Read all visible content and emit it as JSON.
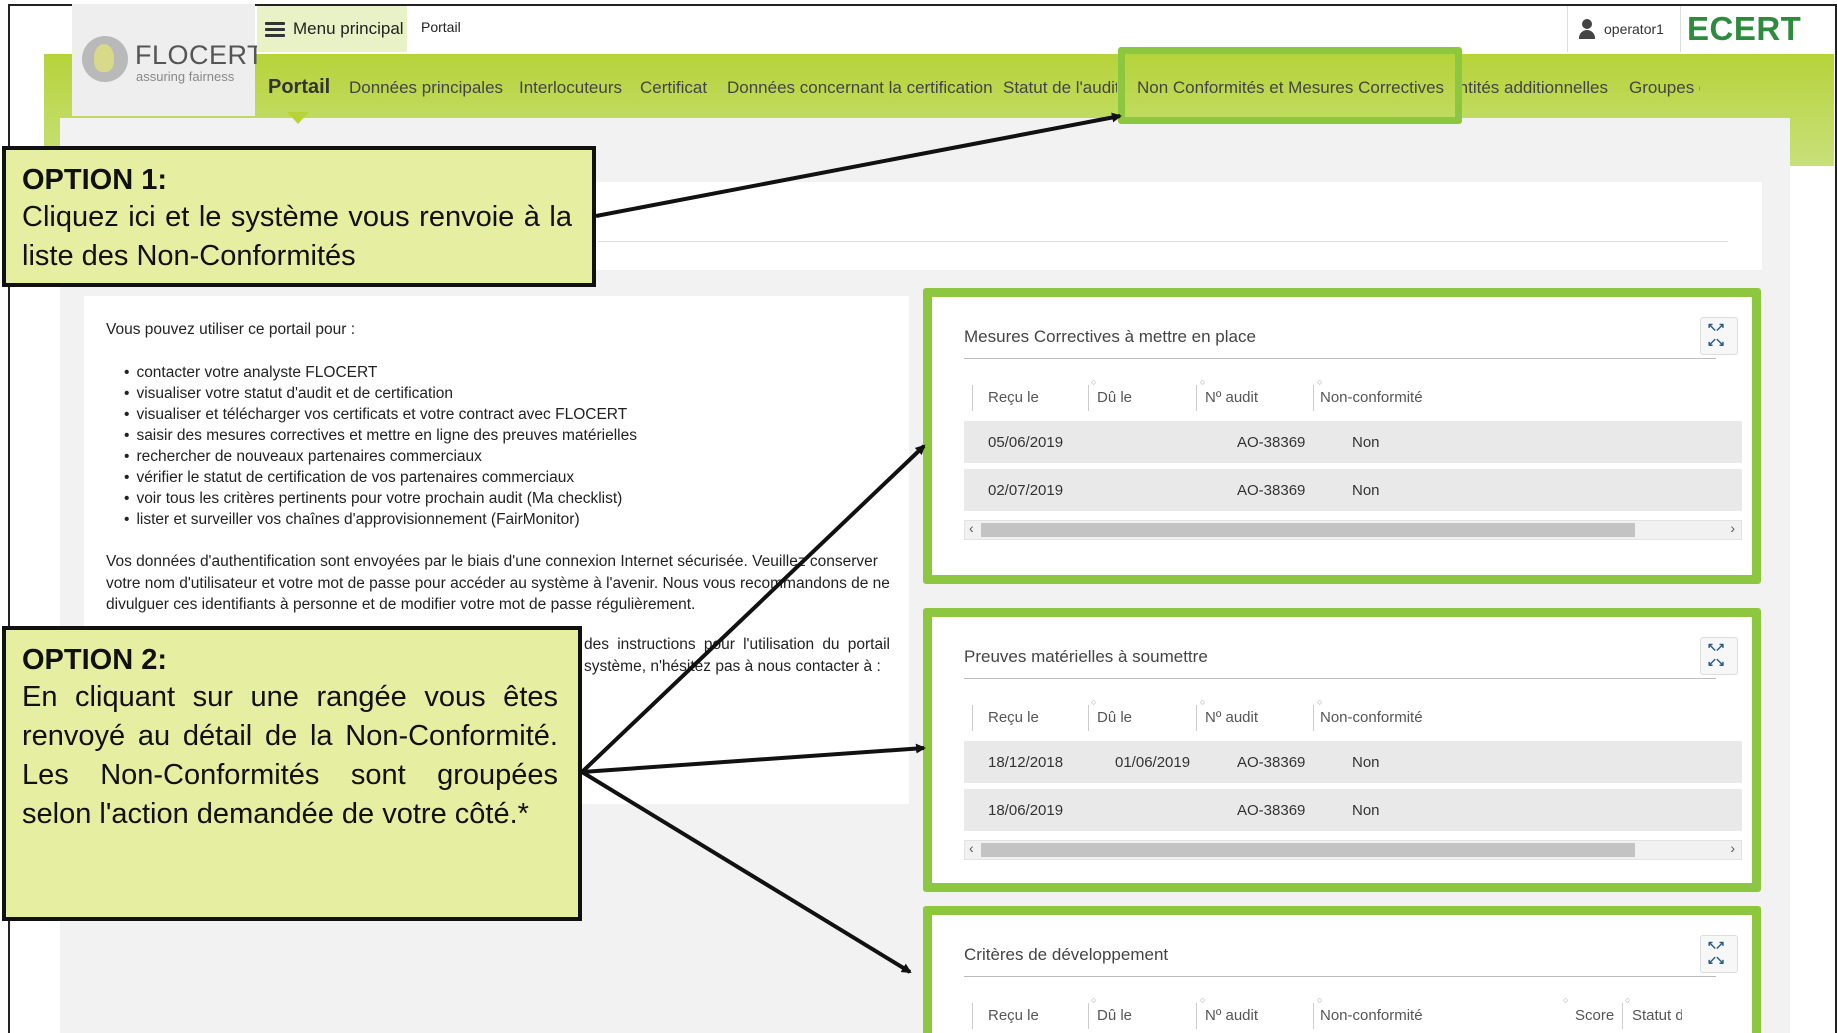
{
  "header": {
    "logo_name": "FLOCERT",
    "logo_tagline": "assuring fairness",
    "menu_label": "Menu principal",
    "breadcrumb": "Portail",
    "user": "operator1",
    "brand": "ECERT"
  },
  "nav": {
    "items": [
      "Portail",
      "Données principales",
      "Interlocuteurs",
      "Certificat",
      "Données concernant la certification",
      "Statut de l'audit",
      "Non Conformités et Mesures Correctives",
      "Entités additionnelles",
      "Groupes d"
    ],
    "active": "Portail"
  },
  "info": {
    "intro": "Vous pouvez utiliser ce portail pour :",
    "bullets": [
      "contacter votre analyste FLOCERT",
      "visualiser votre statut d'audit et de certification",
      "visualiser et télécharger vos certificats et votre contract avec FLOCERT",
      "saisir des mesures correctives et mettre en ligne des preuves matérielles",
      "rechercher de nouveaux partenaires commerciaux",
      "vérifier le statut de certification de vos partenaires commerciaux",
      "voir tous les critères pertinents pour votre prochain audit (Ma checklist)",
      "lister et surveiller vos chaînes d'approvisionnement (FairMonitor)"
    ],
    "security_paragraph": "Vos données d'authentification sont envoyées par le biais d'une connexion Internet sécurisée. Veuillez conserver votre nom d'utilisateur et votre mot de passe pour accéder au système à l'avenir. Nous vous recommandons de ne divulguer ces identifiants à personne et de modifier votre mot de passe régulièrement.",
    "contact_fragment": "des instructions pour l'utilisation du portail système, n'hésitez pas à nous contacter à :"
  },
  "notes": {
    "option1_title": "OPTION 1:",
    "option1_body": "Cliquez ici et le système vous renvoie à la liste des Non-Conformités",
    "option2_title": "OPTION 2:",
    "option2_body": "En cliquant sur une rangée vous êtes renvoyé au détail de la Non-Conformité. Les Non-Conformités sont groupées selon l'action demandée de votre côté.*"
  },
  "panels": [
    {
      "title": "Mesures Correctives à mettre en place",
      "columns": [
        "Reçu le",
        "Dû le",
        "Nº audit",
        "Non-conformité"
      ],
      "rows": [
        [
          "05/06/2019",
          "",
          "AO-38369",
          "Non"
        ],
        [
          "02/07/2019",
          "",
          "AO-38369",
          "Non"
        ]
      ]
    },
    {
      "title": "Preuves matérielles à soumettre",
      "columns": [
        "Reçu le",
        "Dû le",
        "Nº audit",
        "Non-conformité"
      ],
      "rows": [
        [
          "18/12/2018",
          "01/06/2019",
          "AO-38369",
          "Non"
        ],
        [
          "18/06/2019",
          "",
          "AO-38369",
          "Non"
        ]
      ]
    },
    {
      "title": "Critères de développement",
      "columns": [
        "Reçu le",
        "Dû le",
        "Nº audit",
        "Non-conformité",
        "Score",
        "Statut d"
      ],
      "rows": []
    }
  ],
  "colors": {
    "brand_green": "#b6d33a",
    "highlight_green": "#8dc63f",
    "note_fill": "#e6eea1",
    "ecert_green": "#2e8b3e"
  }
}
